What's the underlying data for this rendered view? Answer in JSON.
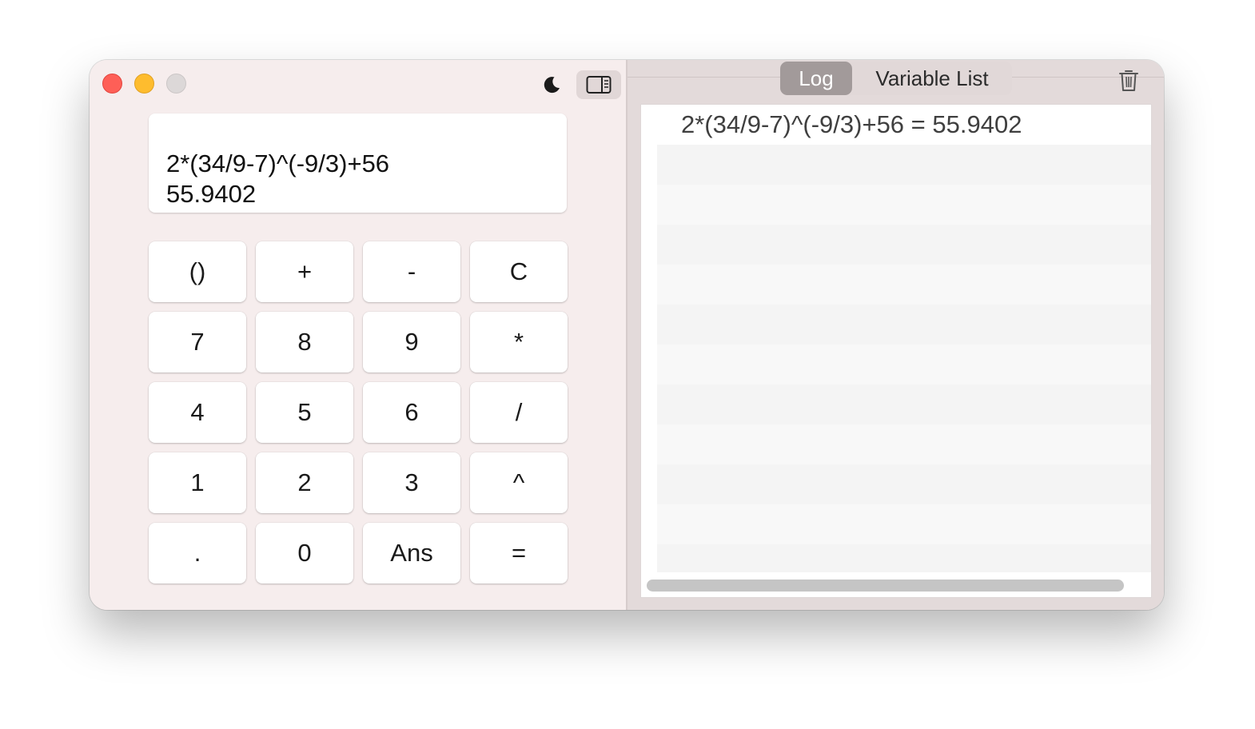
{
  "calculator": {
    "display": {
      "expression": "2*(34/9-7)^(-9/3)+56",
      "result": "55.9402"
    },
    "keys": [
      [
        "()",
        "+",
        "-",
        "C"
      ],
      [
        "7",
        "8",
        "9",
        "*"
      ],
      [
        "4",
        "5",
        "6",
        "/"
      ],
      [
        "1",
        "2",
        "3",
        "^"
      ],
      [
        ".",
        "0",
        "Ans",
        "="
      ]
    ],
    "toolbar": {
      "theme_icon": "moon-icon",
      "sidebar_icon": "sidebar-toggle-icon"
    }
  },
  "side_panel": {
    "tabs": [
      {
        "label": "Log",
        "active": true
      },
      {
        "label": "Variable List",
        "active": false
      }
    ],
    "trash_icon": "trash-icon",
    "log_entries": [
      "2*(34/9-7)^(-9/3)+56 = 55.9402"
    ]
  },
  "colors": {
    "close": "#fe5f57",
    "minimize": "#febc2e",
    "zoom_disabled": "#dcd8d8",
    "pane_bg": "#f6eded",
    "active_tab": "#a29a9a"
  }
}
